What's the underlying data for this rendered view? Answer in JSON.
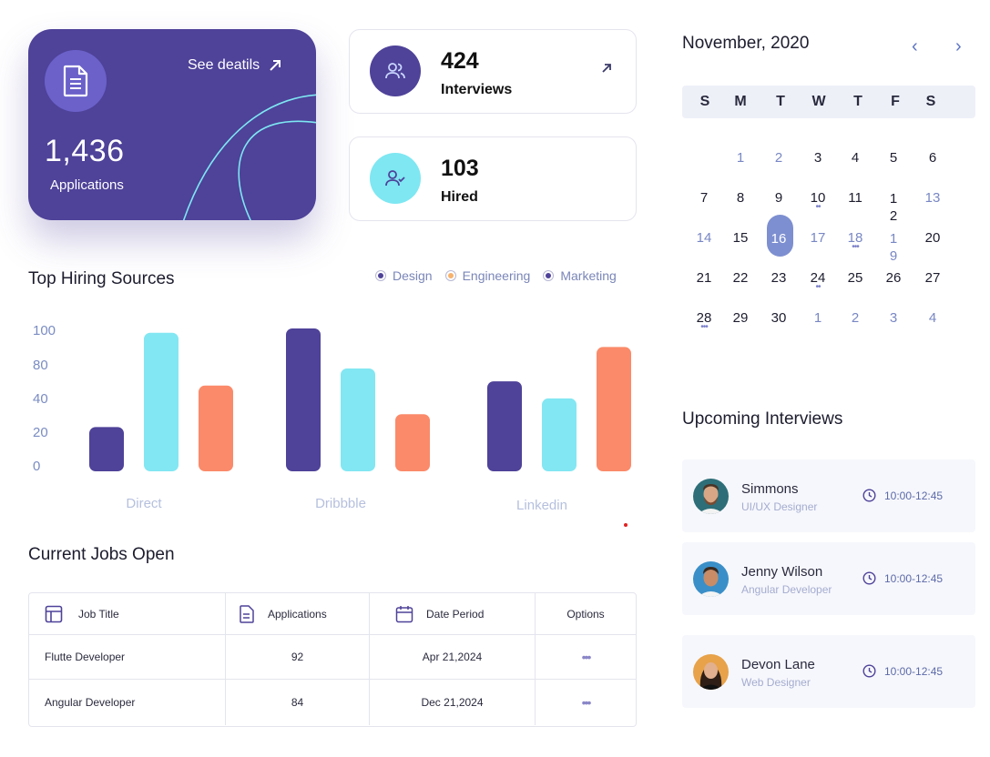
{
  "applications_card": {
    "count": "1,436",
    "label": "Applications",
    "link_label": "See deatils",
    "icon": "document-icon"
  },
  "stats": [
    {
      "value": "424",
      "label": "Interviews",
      "icon": "users-icon",
      "circle_color": "#4e4299",
      "arrow": true
    },
    {
      "value": "103",
      "label": "Hired",
      "icon": "user-check-icon",
      "circle_color": "#7ee7f2",
      "arrow": false
    }
  ],
  "hiring": {
    "title": "Top Hiring Sources",
    "legend": [
      {
        "name": "Design",
        "color": "#4e4299"
      },
      {
        "name": "Engineering",
        "color": "#f7b26d"
      },
      {
        "name": "Marketing",
        "color": "#4e4299"
      }
    ]
  },
  "chart_data": {
    "type": "bar",
    "title": "Top Hiring Sources",
    "categories": [
      "Direct",
      "Dribbble",
      "Linkedin"
    ],
    "y_ticks": [
      "100",
      "80",
      "40",
      "20",
      "0"
    ],
    "series": [
      {
        "name": "Design",
        "color": "#4e4299",
        "values": [
          31,
          100,
          63
        ]
      },
      {
        "name": "Engineering",
        "color": "#82e7f2",
        "values": [
          97,
          72,
          51
        ]
      },
      {
        "name": "Marketing",
        "color": "#fb8a6a",
        "values": [
          60,
          40,
          87
        ]
      }
    ]
  },
  "jobs": {
    "title": "Current Jobs Open",
    "headers": [
      "Job Title",
      "Applications",
      "Date Period",
      "Options"
    ],
    "rows": [
      {
        "title": "Flutte Developer",
        "applications": "92",
        "date": "Apr 21,2024",
        "options": "•••"
      },
      {
        "title": "Angular Developer",
        "applications": "84",
        "date": "Dec 21,2024",
        "options": "•••"
      }
    ]
  },
  "calendar": {
    "title": "November, 2020",
    "prev": "‹",
    "next": "›",
    "weekdays": [
      "S",
      "M",
      "T",
      "W",
      "T",
      "F",
      "S"
    ],
    "selected": "16"
  },
  "interviews": {
    "title": "Upcoming Interviews",
    "items": [
      {
        "name": "Simmons",
        "role": "UI/UX Designer",
        "time": "10:00-12:45"
      },
      {
        "name": "Jenny Wilson",
        "role": "Angular Developer",
        "time": "10:00-12:45"
      },
      {
        "name": "Devon Lane",
        "role": "Web Designer",
        "time": "10:00-12:45"
      }
    ]
  },
  "colors": {
    "primary": "#4e4299",
    "cyan": "#82e7f2",
    "coral": "#fb8a6a",
    "muted_blue": "#7887c4"
  }
}
